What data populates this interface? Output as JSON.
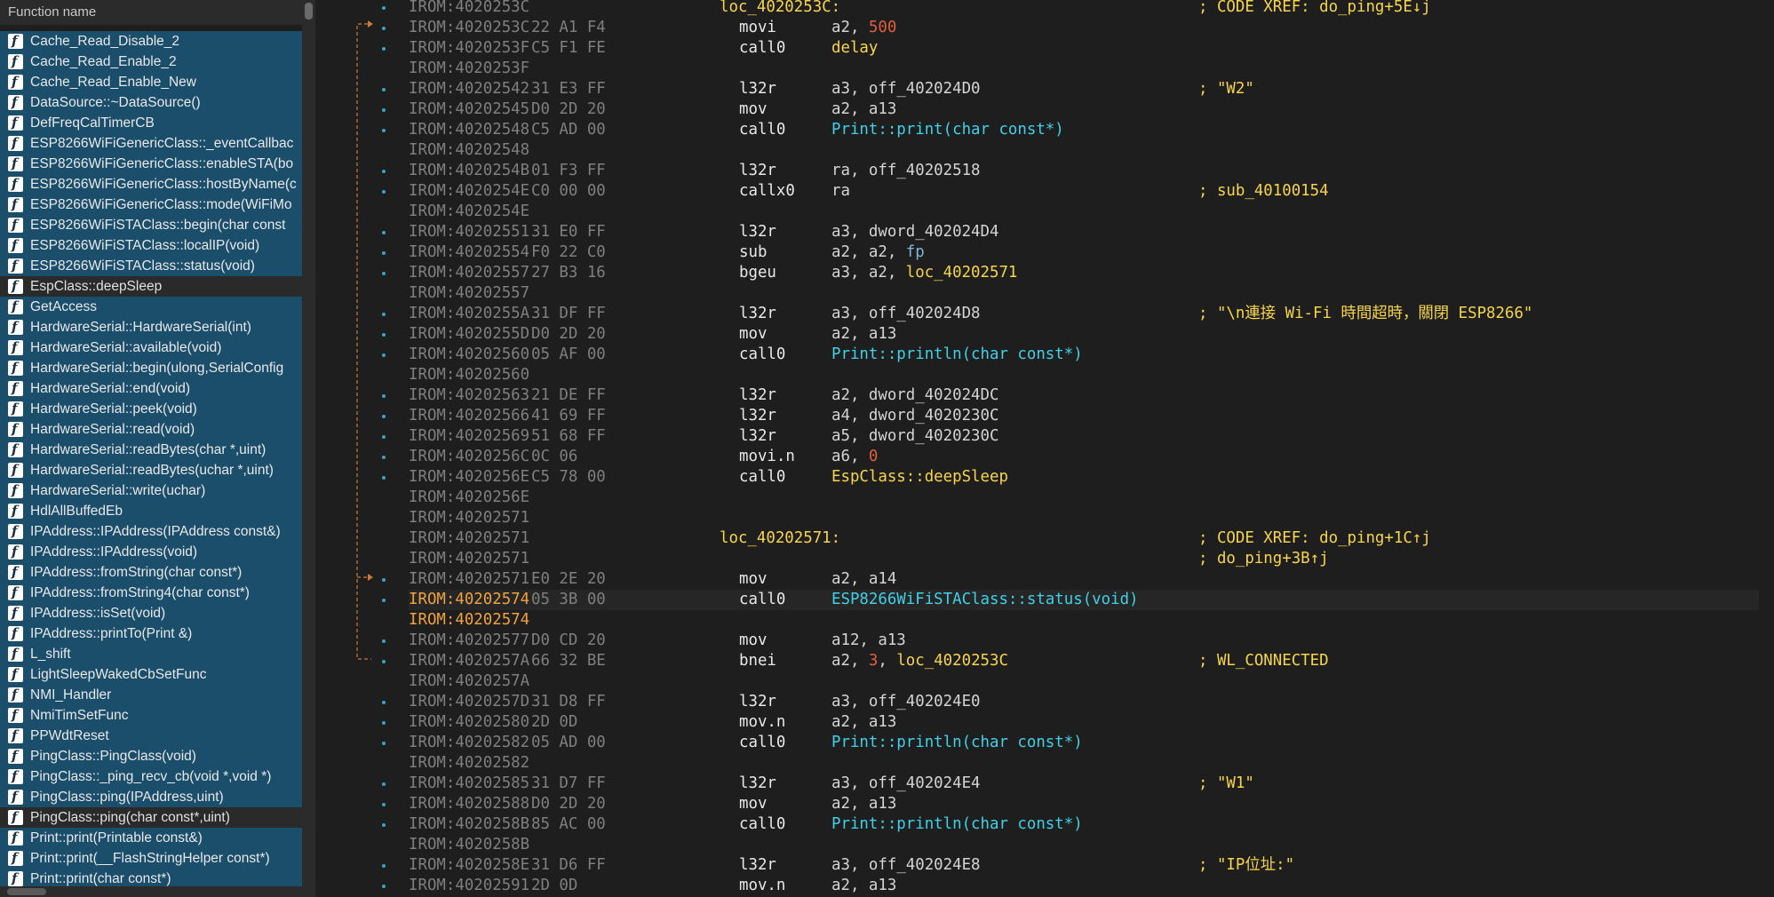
{
  "sidebar": {
    "header": "Function name",
    "items": [
      {
        "label": "Cache_Read_Disable_2",
        "selected": false
      },
      {
        "label": "Cache_Read_Enable_2",
        "selected": false
      },
      {
        "label": "Cache_Read_Enable_New",
        "selected": false
      },
      {
        "label": "DataSource::~DataSource()",
        "selected": false
      },
      {
        "label": "DefFreqCalTimerCB",
        "selected": false
      },
      {
        "label": "ESP8266WiFiGenericClass::_eventCallbac",
        "selected": false
      },
      {
        "label": "ESP8266WiFiGenericClass::enableSTA(bo",
        "selected": false
      },
      {
        "label": "ESP8266WiFiGenericClass::hostByName(c",
        "selected": false
      },
      {
        "label": "ESP8266WiFiGenericClass::mode(WiFiMo",
        "selected": false
      },
      {
        "label": "ESP8266WiFiSTAClass::begin(char const",
        "selected": false
      },
      {
        "label": "ESP8266WiFiSTAClass::localIP(void)",
        "selected": false
      },
      {
        "label": "ESP8266WiFiSTAClass::status(void)",
        "selected": false
      },
      {
        "label": "EspClass::deepSleep",
        "selected": true
      },
      {
        "label": "GetAccess",
        "selected": false
      },
      {
        "label": "HardwareSerial::HardwareSerial(int)",
        "selected": false
      },
      {
        "label": "HardwareSerial::available(void)",
        "selected": false
      },
      {
        "label": "HardwareSerial::begin(ulong,SerialConfig",
        "selected": false
      },
      {
        "label": "HardwareSerial::end(void)",
        "selected": false
      },
      {
        "label": "HardwareSerial::peek(void)",
        "selected": false
      },
      {
        "label": "HardwareSerial::read(void)",
        "selected": false
      },
      {
        "label": "HardwareSerial::readBytes(char *,uint)",
        "selected": false
      },
      {
        "label": "HardwareSerial::readBytes(uchar *,uint)",
        "selected": false
      },
      {
        "label": "HardwareSerial::write(uchar)",
        "selected": false
      },
      {
        "label": "HdlAllBuffedEb",
        "selected": false
      },
      {
        "label": "IPAddress::IPAddress(IPAddress const&)",
        "selected": false
      },
      {
        "label": "IPAddress::IPAddress(void)",
        "selected": false
      },
      {
        "label": "IPAddress::fromString(char const*)",
        "selected": false
      },
      {
        "label": "IPAddress::fromString4(char const*)",
        "selected": false
      },
      {
        "label": "IPAddress::isSet(void)",
        "selected": false
      },
      {
        "label": "IPAddress::printTo(Print &)",
        "selected": false
      },
      {
        "label": "L_shift",
        "selected": false
      },
      {
        "label": "LightSleepWakedCbSetFunc",
        "selected": false
      },
      {
        "label": "NMI_Handler",
        "selected": false
      },
      {
        "label": "NmiTimSetFunc",
        "selected": false
      },
      {
        "label": "PPWdtReset",
        "selected": false
      },
      {
        "label": "PingClass::PingClass(void)",
        "selected": false
      },
      {
        "label": "PingClass::_ping_recv_cb(void *,void *)",
        "selected": false
      },
      {
        "label": "PingClass::ping(IPAddress,uint)",
        "selected": false
      },
      {
        "label": "PingClass::ping(char const*,uint)",
        "selected": true
      },
      {
        "label": "Print::print(Printable const&)",
        "selected": false
      },
      {
        "label": "Print::print(__FlashStringHelper const*)",
        "selected": false
      },
      {
        "label": "Print::print(char const*)",
        "selected": false
      }
    ]
  },
  "code": {
    "lines": [
      {
        "addr": "IROM:4020253C",
        "bytes": "",
        "label": "loc_4020253C:",
        "comment": "; CODE XREF: do_ping+5E↓j",
        "dot": true
      },
      {
        "addr": "IROM:4020253C",
        "bytes": "22 A1 F4",
        "mn": "movi",
        "ops": [
          {
            "t": "a2, ",
            "c": "op"
          },
          {
            "t": "500",
            "c": "num"
          }
        ],
        "dot": true
      },
      {
        "addr": "IROM:4020253F",
        "bytes": "C5 F1 FE",
        "mn": "call0",
        "ops": [
          {
            "t": "delay",
            "c": "sym"
          }
        ],
        "dot": true
      },
      {
        "addr": "IROM:4020253F",
        "bytes": ""
      },
      {
        "addr": "IROM:40202542",
        "bytes": "31 E3 FF",
        "mn": "l32r",
        "ops": [
          {
            "t": "a3, off_402024D0",
            "c": "op"
          }
        ],
        "comment": "; \"W2\"",
        "dot": true
      },
      {
        "addr": "IROM:40202545",
        "bytes": "D0 2D 20",
        "mn": "mov",
        "ops": [
          {
            "t": "a2, a13",
            "c": "op"
          }
        ],
        "dot": true
      },
      {
        "addr": "IROM:40202548",
        "bytes": "C5 AD 00",
        "mn": "call0",
        "ops": [
          {
            "t": "Print::print(char const*)",
            "c": "fn"
          }
        ],
        "dot": true
      },
      {
        "addr": "IROM:40202548",
        "bytes": ""
      },
      {
        "addr": "IROM:4020254B",
        "bytes": "01 F3 FF",
        "mn": "l32r",
        "ops": [
          {
            "t": "ra, off_40202518",
            "c": "op"
          }
        ],
        "dot": true
      },
      {
        "addr": "IROM:4020254E",
        "bytes": "C0 00 00",
        "mn": "callx0",
        "ops": [
          {
            "t": "ra",
            "c": "op"
          }
        ],
        "comment": "; sub_40100154",
        "dot": true
      },
      {
        "addr": "IROM:4020254E",
        "bytes": ""
      },
      {
        "addr": "IROM:40202551",
        "bytes": "31 E0 FF",
        "mn": "l32r",
        "ops": [
          {
            "t": "a3, dword_402024D4",
            "c": "op"
          }
        ],
        "dot": true
      },
      {
        "addr": "IROM:40202554",
        "bytes": "F0 22 C0",
        "mn": "sub",
        "ops": [
          {
            "t": "a2, a2, ",
            "c": "op"
          },
          {
            "t": "fp",
            "c": "fp"
          }
        ],
        "dot": true
      },
      {
        "addr": "IROM:40202557",
        "bytes": "27 B3 16",
        "mn": "bgeu",
        "ops": [
          {
            "t": "a3, a2, ",
            "c": "op"
          },
          {
            "t": "loc_40202571",
            "c": "sym"
          }
        ],
        "dot": true
      },
      {
        "addr": "IROM:40202557",
        "bytes": ""
      },
      {
        "addr": "IROM:4020255A",
        "bytes": "31 DF FF",
        "mn": "l32r",
        "ops": [
          {
            "t": "a3, off_402024D8",
            "c": "op"
          }
        ],
        "comment": "; \"\\n連接 Wi-Fi 時間超時，關閉 ESP8266\"",
        "dot": true
      },
      {
        "addr": "IROM:4020255D",
        "bytes": "D0 2D 20",
        "mn": "mov",
        "ops": [
          {
            "t": "a2, a13",
            "c": "op"
          }
        ],
        "dot": true
      },
      {
        "addr": "IROM:40202560",
        "bytes": "05 AF 00",
        "mn": "call0",
        "ops": [
          {
            "t": "Print::println(char const*)",
            "c": "fn"
          }
        ],
        "dot": true
      },
      {
        "addr": "IROM:40202560",
        "bytes": ""
      },
      {
        "addr": "IROM:40202563",
        "bytes": "21 DE FF",
        "mn": "l32r",
        "ops": [
          {
            "t": "a2, dword_402024DC",
            "c": "op"
          }
        ],
        "dot": true
      },
      {
        "addr": "IROM:40202566",
        "bytes": "41 69 FF",
        "mn": "l32r",
        "ops": [
          {
            "t": "a4, dword_4020230C",
            "c": "op"
          }
        ],
        "dot": true
      },
      {
        "addr": "IROM:40202569",
        "bytes": "51 68 FF",
        "mn": "l32r",
        "ops": [
          {
            "t": "a5, dword_4020230C",
            "c": "op"
          }
        ],
        "dot": true
      },
      {
        "addr": "IROM:4020256C",
        "bytes": "0C 06",
        "mn": "movi.n",
        "ops": [
          {
            "t": "a6, ",
            "c": "op"
          },
          {
            "t": "0",
            "c": "num"
          }
        ],
        "dot": true
      },
      {
        "addr": "IROM:4020256E",
        "bytes": "C5 78 00",
        "mn": "call0",
        "ops": [
          {
            "t": "EspClass::deepSleep",
            "c": "sym"
          }
        ],
        "dot": true
      },
      {
        "addr": "IROM:4020256E",
        "bytes": ""
      },
      {
        "addr": "IROM:40202571",
        "bytes": ""
      },
      {
        "addr": "IROM:40202571",
        "bytes": "",
        "label": "loc_40202571:",
        "comment": "; CODE XREF: do_ping+1C↑j"
      },
      {
        "addr": "IROM:40202571",
        "bytes": "",
        "comment": "; do_ping+3B↑j"
      },
      {
        "addr": "IROM:40202571",
        "bytes": "E0 2E 20",
        "mn": "mov",
        "ops": [
          {
            "t": "a2, a14",
            "c": "op"
          }
        ],
        "dot": true
      },
      {
        "addr": "IROM:40202574",
        "bytes": "05 3B 00",
        "mn": "call0",
        "ops": [
          {
            "t": "ESP8266WiFiSTAClass::status(void)",
            "c": "fn"
          }
        ],
        "dot": true,
        "hi": true,
        "cur": true
      },
      {
        "addr": "IROM:40202574",
        "bytes": "",
        "hi": true
      },
      {
        "addr": "IROM:40202577",
        "bytes": "D0 CD 20",
        "mn": "mov",
        "ops": [
          {
            "t": "a12, a13",
            "c": "op"
          }
        ],
        "dot": true
      },
      {
        "addr": "IROM:4020257A",
        "bytes": "66 32 BE",
        "mn": "bnei",
        "ops": [
          {
            "t": "a2, ",
            "c": "op"
          },
          {
            "t": "3",
            "c": "num"
          },
          {
            "t": ", ",
            "c": "op"
          },
          {
            "t": "loc_4020253C",
            "c": "sym"
          }
        ],
        "comment": "; WL_CONNECTED",
        "dot": true
      },
      {
        "addr": "IROM:4020257A",
        "bytes": ""
      },
      {
        "addr": "IROM:4020257D",
        "bytes": "31 D8 FF",
        "mn": "l32r",
        "ops": [
          {
            "t": "a3, off_402024E0",
            "c": "op"
          }
        ],
        "dot": true
      },
      {
        "addr": "IROM:40202580",
        "bytes": "2D 0D",
        "mn": "mov.n",
        "ops": [
          {
            "t": "a2, a13",
            "c": "op"
          }
        ],
        "dot": true
      },
      {
        "addr": "IROM:40202582",
        "bytes": "05 AD 00",
        "mn": "call0",
        "ops": [
          {
            "t": "Print::println(char const*)",
            "c": "fn"
          }
        ],
        "dot": true
      },
      {
        "addr": "IROM:40202582",
        "bytes": ""
      },
      {
        "addr": "IROM:40202585",
        "bytes": "31 D7 FF",
        "mn": "l32r",
        "ops": [
          {
            "t": "a3, off_402024E4",
            "c": "op"
          }
        ],
        "comment": "; \"W1\"",
        "dot": true
      },
      {
        "addr": "IROM:40202588",
        "bytes": "D0 2D 20",
        "mn": "mov",
        "ops": [
          {
            "t": "a2, a13",
            "c": "op"
          }
        ],
        "dot": true
      },
      {
        "addr": "IROM:4020258B",
        "bytes": "85 AC 00",
        "mn": "call0",
        "ops": [
          {
            "t": "Print::println(char const*)",
            "c": "fn"
          }
        ],
        "dot": true
      },
      {
        "addr": "IROM:4020258B",
        "bytes": ""
      },
      {
        "addr": "IROM:4020258E",
        "bytes": "31 D6 FF",
        "mn": "l32r",
        "ops": [
          {
            "t": "a3, off_402024E8",
            "c": "op"
          }
        ],
        "comment": "; \"IP位址:\"",
        "dot": true
      },
      {
        "addr": "IROM:40202591",
        "bytes": "2D 0D",
        "mn": "mov.n",
        "ops": [
          {
            "t": "a2, a13",
            "c": "op"
          }
        ],
        "dot": true
      }
    ]
  },
  "colors": {
    "sidebar_item_bg": "#1b4e6b",
    "selected_bg": "#2a2a2a",
    "address_highlight": "#f0a23c",
    "symbol": "#f7d54a",
    "function_call": "#3fd1e8",
    "immediate": "#e0603a"
  },
  "icons": {
    "function_item": "function-icon",
    "node_marker": "dot-icon"
  }
}
